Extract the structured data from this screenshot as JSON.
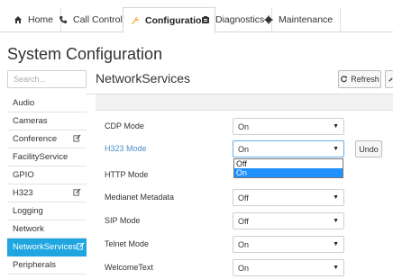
{
  "tabs": [
    {
      "label": "Home",
      "icon": "home-icon"
    },
    {
      "label": "Call Control",
      "icon": "phone-icon"
    },
    {
      "label": "Configuration",
      "icon": "wrench-icon"
    },
    {
      "label": "Diagnostics",
      "icon": "diagnostics-icon"
    },
    {
      "label": "Maintenance",
      "icon": "gear-icon"
    }
  ],
  "page_title": "System Configuration",
  "search": {
    "placeholder": "Search..."
  },
  "sidebar": {
    "items": [
      {
        "label": "Audio"
      },
      {
        "label": "Cameras"
      },
      {
        "label": "Conference"
      },
      {
        "label": "FacilityService"
      },
      {
        "label": "GPIO"
      },
      {
        "label": "H323"
      },
      {
        "label": "Logging"
      },
      {
        "label": "Network"
      },
      {
        "label": "NetworkServices"
      },
      {
        "label": "Peripherals"
      }
    ]
  },
  "main": {
    "title": "NetworkServices",
    "refresh_label": "Refresh",
    "undo_label": "Undo",
    "settings": [
      {
        "label": "CDP Mode",
        "value": "On"
      },
      {
        "label": "H323 Mode",
        "value": "On"
      },
      {
        "label": "HTTP Mode",
        "value": ""
      },
      {
        "label": "Medianet Metadata",
        "value": "Off"
      },
      {
        "label": "SIP Mode",
        "value": "Off"
      },
      {
        "label": "Telnet Mode",
        "value": "On"
      },
      {
        "label": "WelcomeText",
        "value": "On"
      }
    ],
    "dropdown_options": [
      {
        "label": "Off"
      },
      {
        "label": "On"
      }
    ]
  },
  "colors": {
    "accent": "#1fa6e0",
    "link": "#4a8fc9",
    "dropdown_selected": "#1e90ff",
    "active_tab_icon": "#f0a020"
  }
}
